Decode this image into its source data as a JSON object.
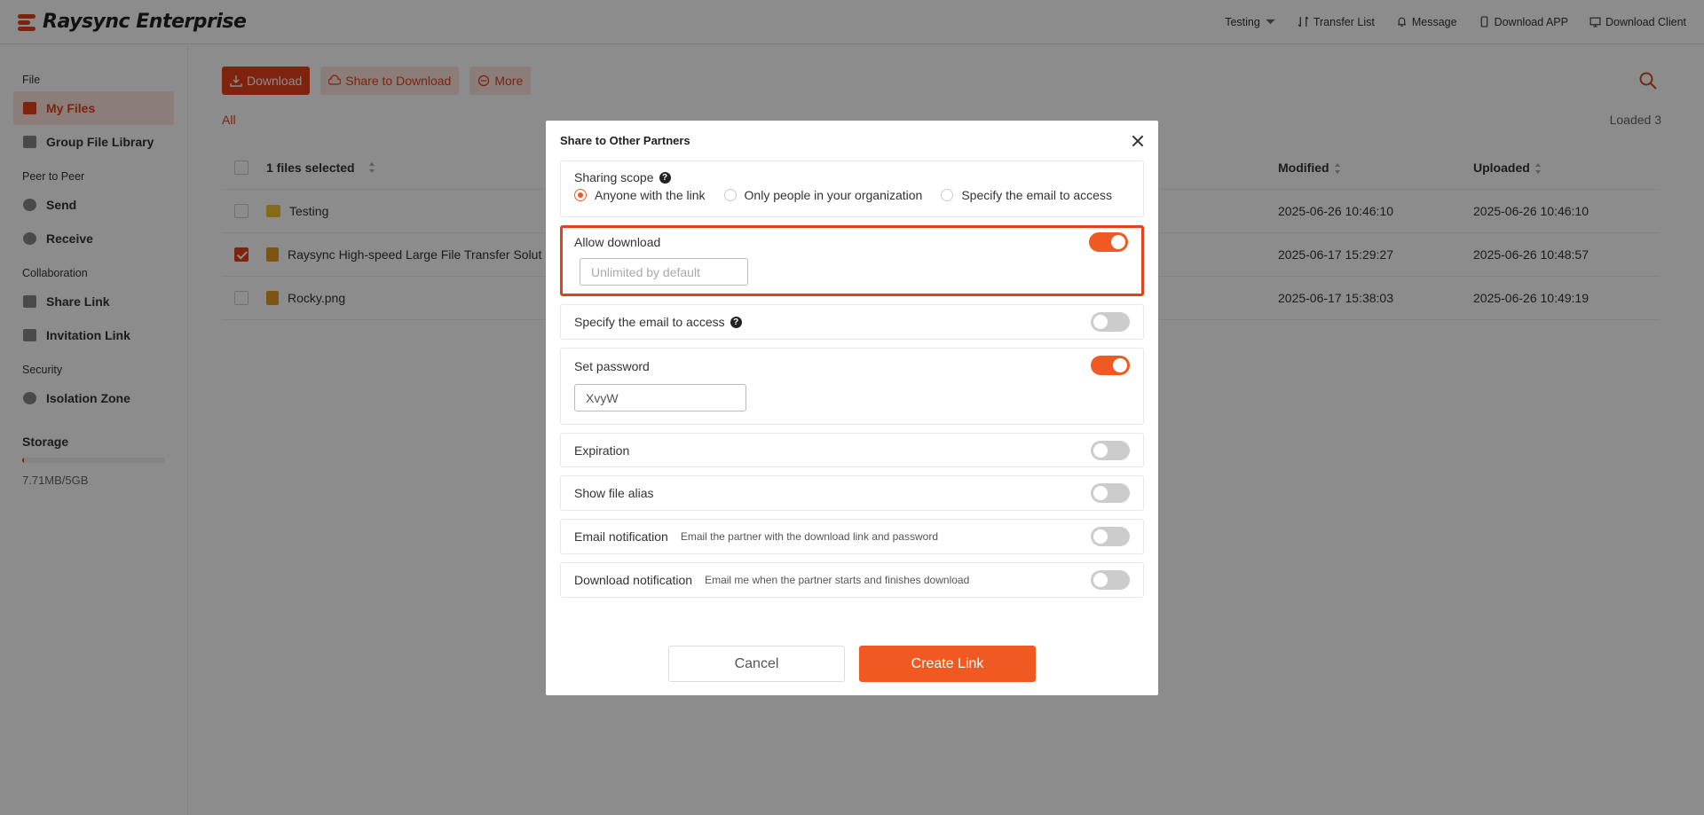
{
  "app": {
    "title": "Raysync Enterprise"
  },
  "topnav": {
    "user": "Testing",
    "transfer_list": "Transfer List",
    "message": "Message",
    "download_app": "Download APP",
    "download_client": "Download Client"
  },
  "sidebar": {
    "sections": {
      "file": "File",
      "p2p": "Peer to Peer",
      "collab": "Collaboration",
      "security": "Security"
    },
    "items": {
      "my_files": "My Files",
      "group_library": "Group File Library",
      "send": "Send",
      "receive": "Receive",
      "share_link": "Share Link",
      "invitation_link": "Invitation Link",
      "isolation_zone": "Isolation Zone"
    },
    "storage": {
      "title": "Storage",
      "used": "7.71MB/5GB",
      "used_fraction": 0.0015
    }
  },
  "toolbar": {
    "download": "Download",
    "share_to_download": "Share to Download",
    "more": "More"
  },
  "breadcrumb": "All",
  "loaded": "Loaded 3",
  "table": {
    "headers": {
      "name": "1 files selected",
      "modified": "Modified",
      "uploaded": "Uploaded"
    },
    "rows": [
      {
        "name": "Testing",
        "modified": "2025-06-26 10:46:10",
        "uploaded": "2025-06-26 10:46:10",
        "type": "folder",
        "checked": false
      },
      {
        "name": "Raysync High-speed Large File Transfer Solut",
        "modified": "2025-06-17 15:29:27",
        "uploaded": "2025-06-26 10:48:57",
        "type": "doc",
        "checked": true
      },
      {
        "name": "Rocky.png",
        "modified": "2025-06-17 15:38:03",
        "uploaded": "2025-06-26 10:49:19",
        "type": "doc",
        "checked": false
      }
    ]
  },
  "modal": {
    "title": "Share to Other Partners",
    "sharing_scope": {
      "label": "Sharing scope",
      "options": [
        "Anyone with the link",
        "Only people in your organization",
        "Specify the email to access"
      ],
      "selected": 0
    },
    "allow_download": {
      "label": "Allow download",
      "on": true,
      "placeholder": "Unlimited by default"
    },
    "specify_email": {
      "label": "Specify the email to access",
      "on": false
    },
    "set_password": {
      "label": "Set password",
      "on": true,
      "value": "XvyW"
    },
    "expiration": {
      "label": "Expiration",
      "on": false
    },
    "show_alias": {
      "label": "Show file alias",
      "on": false
    },
    "email_notification": {
      "label": "Email notification",
      "desc": "Email the partner with the download link and password",
      "on": false
    },
    "download_notification": {
      "label": "Download notification",
      "desc": "Email me when the partner starts and finishes download",
      "on": false
    },
    "cancel": "Cancel",
    "create": "Create Link"
  },
  "colors": {
    "accent": "#e4411b",
    "toggle_on": "#f05a22"
  }
}
